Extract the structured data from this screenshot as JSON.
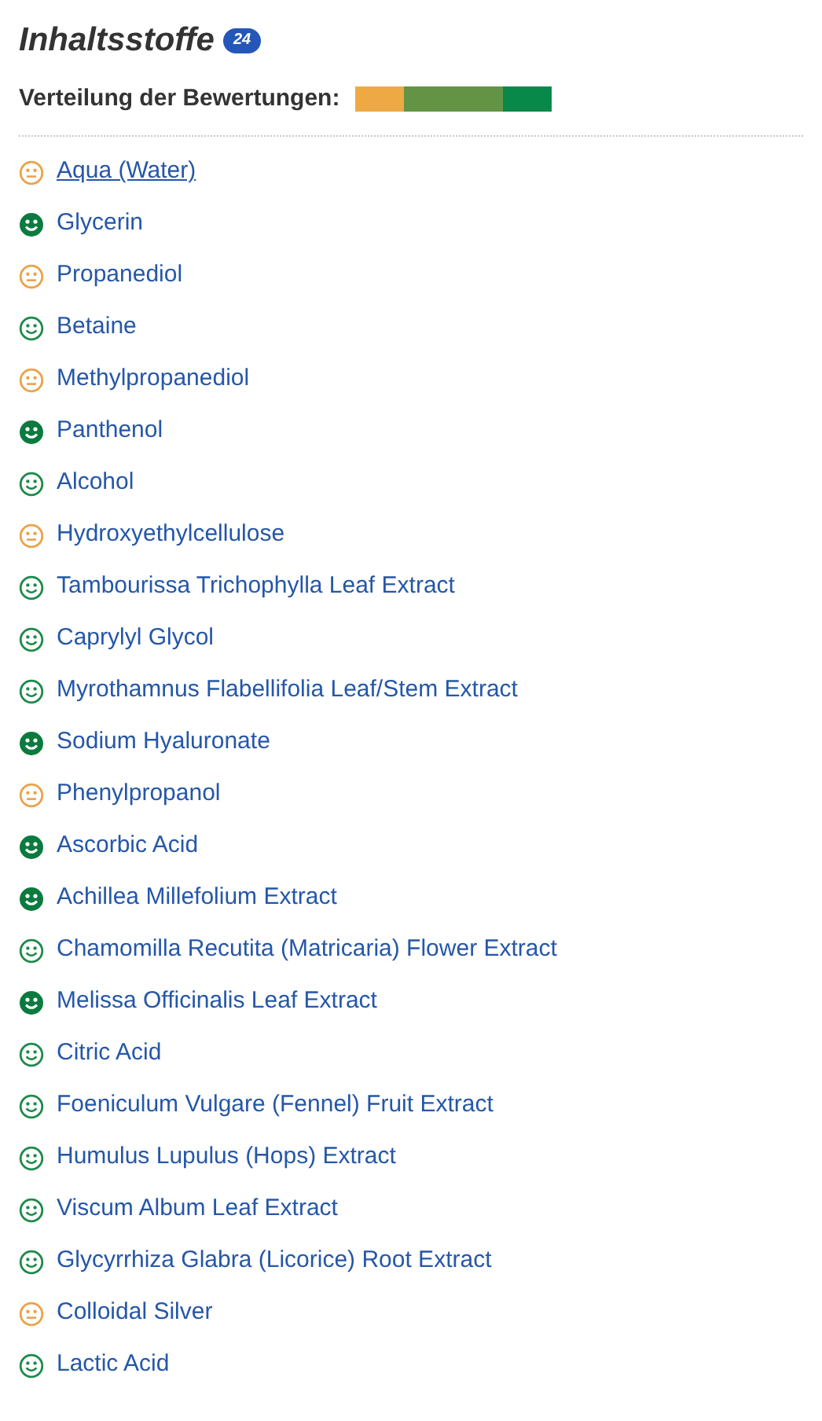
{
  "title": "Inhaltsstoffe",
  "count": "24",
  "distribution": {
    "label": "Verteilung der Bewertungen:",
    "segments": [
      {
        "kind": "neutral",
        "color": "#eea945"
      },
      {
        "kind": "good",
        "color": "#639445"
      },
      {
        "kind": "very_good",
        "color": "#08894a"
      }
    ]
  },
  "ingredients": [
    {
      "name": "Aqua (Water)",
      "kind": "neutral",
      "underlined": true
    },
    {
      "name": "Glycerin",
      "kind": "very_good",
      "underlined": false
    },
    {
      "name": "Propanediol",
      "kind": "neutral",
      "underlined": false
    },
    {
      "name": "Betaine",
      "kind": "good",
      "underlined": false
    },
    {
      "name": "Methylpropanediol",
      "kind": "neutral",
      "underlined": false
    },
    {
      "name": "Panthenol",
      "kind": "very_good",
      "underlined": false
    },
    {
      "name": "Alcohol",
      "kind": "good",
      "underlined": false
    },
    {
      "name": "Hydroxyethylcellulose",
      "kind": "neutral",
      "underlined": false
    },
    {
      "name": "Tambourissa Trichophylla Leaf Extract",
      "kind": "good",
      "underlined": false
    },
    {
      "name": "Caprylyl Glycol",
      "kind": "good",
      "underlined": false
    },
    {
      "name": "Myrothamnus Flabellifolia Leaf/Stem Extract",
      "kind": "good",
      "underlined": false
    },
    {
      "name": "Sodium Hyaluronate",
      "kind": "very_good",
      "underlined": false
    },
    {
      "name": "Phenylpropanol",
      "kind": "neutral",
      "underlined": false
    },
    {
      "name": "Ascorbic Acid",
      "kind": "very_good",
      "underlined": false
    },
    {
      "name": "Achillea Millefolium Extract",
      "kind": "very_good",
      "underlined": false
    },
    {
      "name": "Chamomilla Recutita (Matricaria) Flower Extract",
      "kind": "good",
      "underlined": false
    },
    {
      "name": "Melissa Officinalis Leaf Extract",
      "kind": "very_good",
      "underlined": false
    },
    {
      "name": "Citric Acid",
      "kind": "good",
      "underlined": false
    },
    {
      "name": "Foeniculum Vulgare (Fennel) Fruit Extract",
      "kind": "good",
      "underlined": false
    },
    {
      "name": "Humulus Lupulus (Hops) Extract",
      "kind": "good",
      "underlined": false
    },
    {
      "name": "Viscum Album Leaf Extract",
      "kind": "good",
      "underlined": false
    },
    {
      "name": "Glycyrrhiza Glabra (Licorice) Root Extract",
      "kind": "good",
      "underlined": false
    },
    {
      "name": "Colloidal Silver",
      "kind": "neutral",
      "underlined": false
    },
    {
      "name": "Lactic Acid",
      "kind": "good",
      "underlined": false
    }
  ]
}
